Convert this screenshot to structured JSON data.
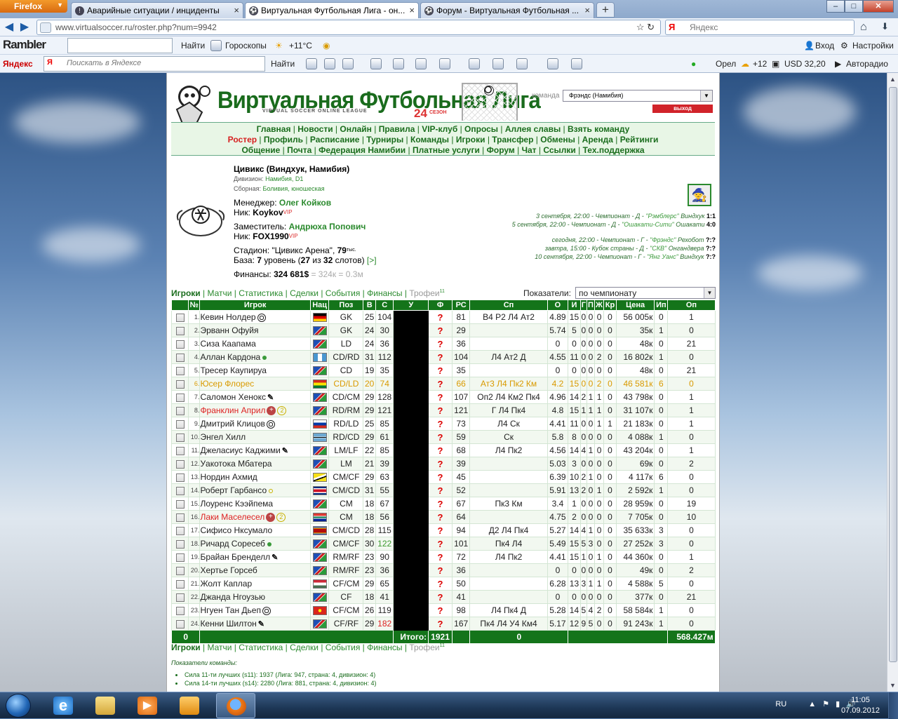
{
  "browser": {
    "firefox_label": "Firefox",
    "tabs": [
      {
        "title": "Аварийные ситуации / инциденты",
        "icon": "incident-icon"
      },
      {
        "title": "Виртуальная Футбольная Лига - он...",
        "icon": "ball-icon"
      },
      {
        "title": "Форум - Виртуальная Футбольная ...",
        "icon": "ball-icon"
      }
    ],
    "url": "www.virtualsoccer.ru/roster.php?num=9942",
    "search_engine": "Яндекс",
    "search_placeholder": "Яндекс",
    "rambler": {
      "logo": "Rambler",
      "find": "Найти",
      "horoscopes": "Гороскопы",
      "weather": "+11°C",
      "login": "Вход",
      "settings": "Настройки"
    },
    "yandex_bar": {
      "logo": "Яндекс",
      "placeholder": "Поискать в Яндексе",
      "find": "Найти",
      "city": "Орел",
      "temp": "+12",
      "currency": "USD 32,20",
      "radio": "Авторадио"
    }
  },
  "site": {
    "title": "Виртуальная Футбольная Лига",
    "subtitle": "VIRTUAL SOCCER ONLINE LEAGUE",
    "season_num": "24",
    "season_label": "СЕЗОН",
    "team_label": "команда",
    "team_value": "Фрэндс (Намибия)",
    "exit": "выход",
    "menu": [
      [
        "Главная",
        "Новости",
        "Онлайн",
        "Правила",
        "VIP-клуб",
        "Опросы",
        "Аллея славы",
        "Взять команду"
      ],
      [
        "Ростер",
        "Профиль",
        "Расписание",
        "Турниры",
        "Команды",
        "Игроки",
        "Трансфер",
        "Обмены",
        "Аренда",
        "Рейтинги"
      ],
      [
        "Общение",
        "Почта",
        "Федерация Намибии",
        "Платные услуги",
        "Форум",
        "Чат",
        "Ссылки",
        "Тех.поддержка"
      ]
    ]
  },
  "club": {
    "name": "Цивикс (Виндхук, Намибия)",
    "division_label": "Дивизион:",
    "division": "Намибия, D1",
    "national_label": "Сборная:",
    "national": "Боливия, юношеская",
    "manager_label": "Менеджер:",
    "manager": "Олег Койков",
    "nick_label": "Ник:",
    "nick": "Koykov",
    "vip": "VIP",
    "deputy_label": "Заместитель:",
    "deputy": "Андрюха Попович",
    "deputy_nick": "FOX1990",
    "stadium_label": "Стадион:",
    "stadium": "\"Цивикс Арена\",",
    "stadium_cap": "79",
    "stadium_unit": "тыс.",
    "base_label": "База:",
    "base_level": "7",
    "base_text": "уровень (",
    "base_used": "27",
    "base_of": "из",
    "base_total": "32",
    "base_tail": "слотов)",
    "base_link": "[>]",
    "finance_label": "Финансы:",
    "finance": "324 681$",
    "finance_extra": "= 324к = 0.3м"
  },
  "matches": [
    {
      "when": "3 сентября, 22:00 - Чемпионат - Д -",
      "opp": "\"Рэмблерс\"",
      "city": "Виндхук",
      "score": "1:1"
    },
    {
      "when": "5 сентября, 22:00 - Чемпионат - Д -",
      "opp": "\"Ошакати-Сити\"",
      "city": "Ошакати",
      "score": "4:0"
    },
    {
      "when": "сегодня, 22:00 - Чемпионат - Г -",
      "opp": "\"Фрэндс\"",
      "city": "Рехобот",
      "score": "?:?"
    },
    {
      "when": "завтра, 15:00 - Кубок страны - Д -",
      "opp": "\"СКВ\"",
      "city": "Онгандвера",
      "score": "?:?"
    },
    {
      "when": "10 сентября, 22:00 - Чемпионат - Г -",
      "opp": "\"Янг Уанс\"",
      "city": "Виндхук",
      "score": "?:?"
    }
  ],
  "subtabs": {
    "players": "Игроки",
    "matches": "Матчи",
    "stats": "Статистика",
    "deals": "Сделки",
    "events": "События",
    "finance": "Финансы",
    "trophies": "Трофеи",
    "trophies_count": "11"
  },
  "indicators_label": "Показатели:",
  "indicators_value": "по чемпионату",
  "columns": [
    "№",
    "Игрок",
    "Нац",
    "Поз",
    "В",
    "С",
    "У",
    "Ф",
    "РС",
    "Сп",
    "О",
    "И",
    "Г",
    "П",
    "Ж",
    "Кр",
    "Цена",
    "Ип",
    "Оп"
  ],
  "players": [
    {
      "n": "1.",
      "name": "Кевин Нолдер",
      "ic": "ball",
      "flag": "de",
      "pos": "GK",
      "v": "25",
      "s": "104",
      "f": "?",
      "rs": "81",
      "sp": "В4 Р2 Л4 Ат2",
      "o": "4.89",
      "i": "15",
      "g": "0",
      "p": "0",
      "zh": "0",
      "kr": "0",
      "price": "56 005к",
      "ip": "0",
      "op": "1"
    },
    {
      "n": "2.",
      "name": "Эрванн Офуйя",
      "ic": "",
      "flag": "na",
      "pos": "GK",
      "v": "24",
      "s": "30",
      "f": "?",
      "rs": "29",
      "sp": "",
      "o": "5.74",
      "i": "5",
      "g": "0",
      "p": "0",
      "zh": "0",
      "kr": "0",
      "price": "35к",
      "ip": "1",
      "op": "0"
    },
    {
      "n": "3.",
      "name": "Сиза Каапама",
      "ic": "",
      "flag": "na",
      "pos": "LD",
      "v": "24",
      "s": "36",
      "f": "?",
      "rs": "36",
      "sp": "",
      "o": "0",
      "i": "0",
      "g": "0",
      "p": "0",
      "zh": "0",
      "kr": "0",
      "price": "48к",
      "ip": "0",
      "op": "21"
    },
    {
      "n": "4.",
      "name": "Аллан Кардона",
      "ic": "dot",
      "flag": "gt",
      "pos": "CD/RD",
      "v": "31",
      "s": "112",
      "f": "?",
      "rs": "104",
      "sp": "Л4 Ат2 Д",
      "o": "4.55",
      "i": "11",
      "g": "0",
      "p": "0",
      "zh": "2",
      "kr": "0",
      "price": "16 802к",
      "ip": "1",
      "op": "0"
    },
    {
      "n": "5.",
      "name": "Тресер Каупируа",
      "ic": "",
      "flag": "na",
      "pos": "CD",
      "v": "19",
      "s": "35",
      "f": "?",
      "rs": "35",
      "sp": "",
      "o": "0",
      "i": "0",
      "g": "0",
      "p": "0",
      "zh": "0",
      "kr": "0",
      "price": "48к",
      "ip": "0",
      "op": "21"
    },
    {
      "n": "6.",
      "name": "Юсер Флорес",
      "ic": "",
      "flag": "bo",
      "pos": "CD/LD",
      "v": "20",
      "s": "74",
      "f": "?",
      "rs": "66",
      "sp": "Ат3 Л4 Пк2 Км",
      "o": "4.2",
      "i": "15",
      "g": "0",
      "p": "0",
      "zh": "2",
      "kr": "0",
      "price": "46 581к",
      "ip": "6",
      "op": "0",
      "hl": true
    },
    {
      "n": "7.",
      "name": "Саломон Хенокс",
      "ic": "run",
      "flag": "na",
      "pos": "CD/CM",
      "v": "29",
      "s": "128",
      "f": "?",
      "rs": "107",
      "sp": "Оп2 Л4 Км2 Пк4",
      "o": "4.96",
      "i": "14",
      "g": "2",
      "p": "1",
      "zh": "1",
      "kr": "0",
      "price": "43 798к",
      "ip": "0",
      "op": "1"
    },
    {
      "n": "8.",
      "name": "Франклин Април",
      "ic": "inj2",
      "flag": "na",
      "pos": "RD/RM",
      "v": "29",
      "s": "121",
      "f": "?",
      "rs": "121",
      "sp": "Г Л4 Пк4",
      "o": "4.8",
      "i": "15",
      "g": "1",
      "p": "1",
      "zh": "1",
      "kr": "0",
      "price": "31 107к",
      "ip": "0",
      "op": "1",
      "red": true
    },
    {
      "n": "9.",
      "name": "Дмитрий Клицов",
      "ic": "ball",
      "flag": "ru",
      "pos": "RD/LD",
      "v": "25",
      "s": "85",
      "f": "?",
      "rs": "73",
      "sp": "Л4 Ск",
      "o": "4.41",
      "i": "11",
      "g": "0",
      "p": "0",
      "zh": "1",
      "kr": "1",
      "price": "21 183к",
      "ip": "0",
      "op": "1"
    },
    {
      "n": "10.",
      "name": "Энгел Хилл",
      "ic": "",
      "flag": "bw",
      "pos": "RD/CD",
      "v": "29",
      "s": "61",
      "f": "?",
      "rs": "59",
      "sp": "Ск",
      "o": "5.8",
      "i": "8",
      "g": "0",
      "p": "0",
      "zh": "0",
      "kr": "0",
      "price": "4 088к",
      "ip": "1",
      "op": "0"
    },
    {
      "n": "11.",
      "name": "Джеласиус Каджими",
      "ic": "run",
      "flag": "na",
      "pos": "LM/LF",
      "v": "22",
      "s": "85",
      "f": "?",
      "rs": "68",
      "sp": "Л4 Пк2",
      "o": "4.56",
      "i": "14",
      "g": "4",
      "p": "1",
      "zh": "0",
      "kr": "0",
      "price": "43 204к",
      "ip": "0",
      "op": "1"
    },
    {
      "n": "12.",
      "name": "Уакотока Мбатера",
      "ic": "",
      "flag": "na",
      "pos": "LM",
      "v": "21",
      "s": "39",
      "f": "?",
      "rs": "39",
      "sp": "",
      "o": "5.03",
      "i": "3",
      "g": "0",
      "p": "0",
      "zh": "0",
      "kr": "0",
      "price": "69к",
      "ip": "0",
      "op": "2"
    },
    {
      "n": "13.",
      "name": "Нордин Ахмид",
      "ic": "",
      "flag": "bn",
      "pos": "CM/CF",
      "v": "29",
      "s": "63",
      "f": "?",
      "rs": "45",
      "sp": "",
      "o": "6.39",
      "i": "10",
      "g": "2",
      "p": "1",
      "zh": "0",
      "kr": "0",
      "price": "4 117к",
      "ip": "6",
      "op": "0"
    },
    {
      "n": "14.",
      "name": "Роберт Гарбансо",
      "ic": "dot2",
      "flag": "cr",
      "pos": "CM/CD",
      "v": "31",
      "s": "55",
      "f": "?",
      "rs": "52",
      "sp": "",
      "o": "5.91",
      "i": "13",
      "g": "2",
      "p": "0",
      "zh": "1",
      "kr": "0",
      "price": "2 592к",
      "ip": "1",
      "op": "0"
    },
    {
      "n": "15.",
      "name": "Лоуренс Кээйпема",
      "ic": "",
      "flag": "na",
      "pos": "CM",
      "v": "18",
      "s": "67",
      "f": "?",
      "rs": "67",
      "sp": "Пк3 Км",
      "o": "3.4",
      "i": "1",
      "g": "0",
      "p": "0",
      "zh": "0",
      "kr": "0",
      "price": "28 959к",
      "ip": "0",
      "op": "19"
    },
    {
      "n": "16.",
      "name": "Лаки Маселесел",
      "ic": "inj2",
      "flag": "za",
      "pos": "CM",
      "v": "18",
      "s": "56",
      "f": "?",
      "rs": "64",
      "sp": "",
      "o": "4.75",
      "i": "2",
      "g": "0",
      "p": "0",
      "zh": "0",
      "kr": "0",
      "price": "7 705к",
      "ip": "0",
      "op": "10",
      "red": true
    },
    {
      "n": "17.",
      "name": "Сифисо Нксумало",
      "ic": "",
      "flag": "sz",
      "pos": "CM/CD",
      "v": "28",
      "s": "115",
      "f": "?",
      "rs": "94",
      "sp": "Д2 Л4 Пк4",
      "o": "5.27",
      "i": "14",
      "g": "4",
      "p": "1",
      "zh": "0",
      "kr": "0",
      "price": "35 633к",
      "ip": "3",
      "op": "0"
    },
    {
      "n": "18.",
      "name": "Ричард Соресеб",
      "ic": "dot",
      "flag": "na",
      "pos": "CM/CF",
      "v": "30",
      "s": "122",
      "f": "?",
      "rs": "101",
      "sp": "Пк4 Л4",
      "o": "5.49",
      "i": "15",
      "g": "5",
      "p": "3",
      "zh": "0",
      "kr": "0",
      "price": "27 252к",
      "ip": "3",
      "op": "0",
      "sgreen": true
    },
    {
      "n": "19.",
      "name": "Брайан Бренделл",
      "ic": "run",
      "flag": "na",
      "pos": "RM/RF",
      "v": "23",
      "s": "90",
      "f": "?",
      "rs": "72",
      "sp": "Л4 Пк2",
      "o": "4.41",
      "i": "15",
      "g": "1",
      "p": "0",
      "zh": "1",
      "kr": "0",
      "price": "44 360к",
      "ip": "0",
      "op": "1"
    },
    {
      "n": "20.",
      "name": "Хертье Горсеб",
      "ic": "",
      "flag": "na",
      "pos": "RM/RF",
      "v": "23",
      "s": "36",
      "f": "?",
      "rs": "36",
      "sp": "",
      "o": "0",
      "i": "0",
      "g": "0",
      "p": "0",
      "zh": "0",
      "kr": "0",
      "price": "49к",
      "ip": "0",
      "op": "2"
    },
    {
      "n": "21.",
      "name": "Жолт Каплар",
      "ic": "",
      "flag": "hu",
      "pos": "CF/CM",
      "v": "29",
      "s": "65",
      "f": "?",
      "rs": "50",
      "sp": "",
      "o": "6.28",
      "i": "13",
      "g": "3",
      "p": "1",
      "zh": "1",
      "kr": "0",
      "price": "4 588к",
      "ip": "5",
      "op": "0"
    },
    {
      "n": "22.",
      "name": "Джанда Нгоузью",
      "ic": "",
      "flag": "na",
      "pos": "CF",
      "v": "18",
      "s": "41",
      "f": "?",
      "rs": "41",
      "sp": "",
      "o": "0",
      "i": "0",
      "g": "0",
      "p": "0",
      "zh": "0",
      "kr": "0",
      "price": "377к",
      "ip": "0",
      "op": "21"
    },
    {
      "n": "23.",
      "name": "Нгуен Тан Дьеп",
      "ic": "ball",
      "flag": "vn",
      "pos": "CF/CM",
      "v": "26",
      "s": "119",
      "f": "?",
      "rs": "98",
      "sp": "Л4 Пк4 Д",
      "o": "5.28",
      "i": "14",
      "g": "5",
      "p": "4",
      "zh": "2",
      "kr": "0",
      "price": "58 584к",
      "ip": "1",
      "op": "0"
    },
    {
      "n": "24.",
      "name": "Кенни Шилтон",
      "ic": "run",
      "flag": "na",
      "pos": "CF/RF",
      "v": "29",
      "s": "182",
      "f": "?",
      "rs": "167",
      "sp": "Пк4 Л4 У4 Км4",
      "o": "5.17",
      "i": "12",
      "g": "9",
      "p": "5",
      "zh": "0",
      "kr": "0",
      "price": "91 243к",
      "ip": "1",
      "op": "0",
      "sred": true
    }
  ],
  "totals": {
    "first": "0",
    "label": "Итого:",
    "s": "1921",
    "f": "0",
    "price": "568.427м"
  },
  "team_indicators": {
    "title": "Показатели команды:",
    "lines": [
      "Сила 11-ти лучших (s11): 1937 (Лига: 947, страна: 4, дивизион: 4)",
      "Сила 14-ти лучших (s14): 2280 (Лига: 881, страна: 4, дивизион: 4)"
    ]
  },
  "os": {
    "lang": "RU",
    "time": "11:05",
    "date": "07.09.2012"
  }
}
